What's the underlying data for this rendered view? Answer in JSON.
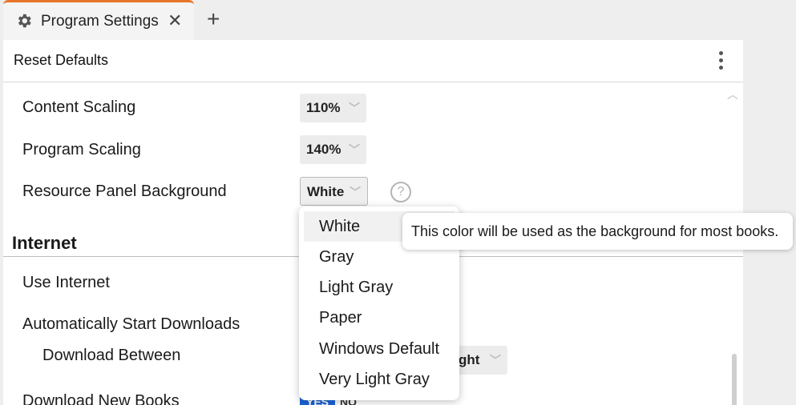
{
  "tab": {
    "title": "Program Settings",
    "close": "✕",
    "new_tab": "+"
  },
  "toolbar": {
    "reset_label": "Reset Defaults"
  },
  "settings": {
    "content_scaling": {
      "label": "Content Scaling",
      "value": "110%"
    },
    "program_scaling": {
      "label": "Program Scaling",
      "value": "140%"
    },
    "resource_panel_background": {
      "label": "Resource Panel Background",
      "value": "White",
      "help": "?"
    }
  },
  "internet": {
    "heading": "Internet",
    "use_internet": "Use Internet",
    "auto_downloads": "Automatically Start Downloads",
    "download_between": {
      "label": "Download Between",
      "value_partial": "ght"
    },
    "download_new_books": {
      "label": "Download New Books",
      "yes": "YES",
      "no": "NO"
    }
  },
  "dropdown": {
    "options": [
      "White",
      "Gray",
      "Light Gray",
      "Paper",
      "Windows Default",
      "Very Light Gray"
    ],
    "selected": "White"
  },
  "tooltip": {
    "text": "This color will be used as the background for most books."
  },
  "colors": {
    "accent_tab": "#e8742a",
    "toggle_on": "#1c64d8"
  }
}
